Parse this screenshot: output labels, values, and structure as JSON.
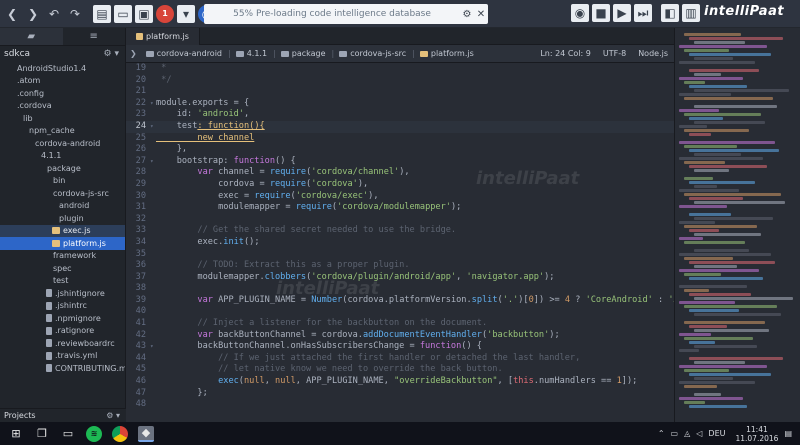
{
  "toolbar": {
    "status_text": "55% Pre-loading code intelligence database",
    "badge": "1"
  },
  "brand": {
    "name": "intelliPaat"
  },
  "watermark": "intelliPaat",
  "sidebar": {
    "root": "sdkca",
    "items": [
      {
        "label": "AndroidStudio1.4",
        "depth": 1,
        "type": "folder"
      },
      {
        "label": ".atom",
        "depth": 1,
        "type": "folder"
      },
      {
        "label": ".config",
        "depth": 1,
        "type": "folder"
      },
      {
        "label": ".cordova",
        "depth": 1,
        "type": "folder"
      },
      {
        "label": "lib",
        "depth": 2,
        "type": "folder"
      },
      {
        "label": "npm_cache",
        "depth": 3,
        "type": "folder"
      },
      {
        "label": "cordova-android",
        "depth": 4,
        "type": "folder"
      },
      {
        "label": "4.1.1",
        "depth": 5,
        "type": "folder"
      },
      {
        "label": "package",
        "depth": 6,
        "type": "folder"
      },
      {
        "label": "bin",
        "depth": 7,
        "type": "folder"
      },
      {
        "label": "cordova-js-src",
        "depth": 7,
        "type": "folder"
      },
      {
        "label": "android",
        "depth": 8,
        "type": "folder"
      },
      {
        "label": "plugin",
        "depth": 8,
        "type": "folder"
      },
      {
        "label": "exec.js",
        "depth": 8,
        "type": "js",
        "state": "hl"
      },
      {
        "label": "platform.js",
        "depth": 8,
        "type": "js",
        "state": "selected"
      },
      {
        "label": "framework",
        "depth": 7,
        "type": "folder"
      },
      {
        "label": "spec",
        "depth": 7,
        "type": "folder"
      },
      {
        "label": "test",
        "depth": 7,
        "type": "folder"
      },
      {
        "label": ".jshintignore",
        "depth": 7,
        "type": "file"
      },
      {
        "label": ".jshintrc",
        "depth": 7,
        "type": "file"
      },
      {
        "label": ".npmignore",
        "depth": 7,
        "type": "file"
      },
      {
        "label": ".ratignore",
        "depth": 7,
        "type": "file"
      },
      {
        "label": ".reviewboardrc",
        "depth": 7,
        "type": "file"
      },
      {
        "label": ".travis.yml",
        "depth": 7,
        "type": "file"
      },
      {
        "label": "CONTRIBUTING.md",
        "depth": 7,
        "type": "file"
      }
    ],
    "projects_label": "Projects"
  },
  "editor": {
    "tab_label": "platform.js",
    "breadcrumbs": [
      "cordova-android",
      "4.1.1",
      "package",
      "cordova-js-src",
      "platform.js"
    ],
    "cursor": "Ln: 24 Col: 9",
    "encoding": "UTF-8",
    "language": "Node.js",
    "lines": [
      {
        "n": "19",
        "tokens": [
          [
            "cm",
            " *"
          ]
        ]
      },
      {
        "n": "20",
        "tokens": [
          [
            "cm",
            " */"
          ]
        ]
      },
      {
        "n": "21",
        "tokens": []
      },
      {
        "n": "22",
        "fold": true,
        "tokens": [
          [
            "pl",
            "module.exports = {"
          ]
        ]
      },
      {
        "n": "23",
        "tokens": [
          [
            "pl",
            "    id: "
          ],
          [
            "str",
            "'android'"
          ],
          [
            "pl",
            ","
          ]
        ]
      },
      {
        "n": "24",
        "cur": true,
        "fold": true,
        "tokens": [
          [
            "pl",
            "    test"
          ],
          [
            "ul",
            ": function(){"
          ]
        ]
      },
      {
        "n": "25",
        "tokens": [
          [
            "ul",
            "        new channel"
          ]
        ]
      },
      {
        "n": "26",
        "tokens": [
          [
            "pl",
            "    },"
          ]
        ]
      },
      {
        "n": "27",
        "fold": true,
        "tokens": [
          [
            "pl",
            "    bootstrap: "
          ],
          [
            "kw",
            "function"
          ],
          [
            "pl",
            "() {"
          ]
        ]
      },
      {
        "n": "28",
        "tokens": [
          [
            "pl",
            "        "
          ],
          [
            "kw",
            "var"
          ],
          [
            "pl",
            " channel = "
          ],
          [
            "fn",
            "require"
          ],
          [
            "pl",
            "("
          ],
          [
            "str",
            "'cordova/channel'"
          ],
          [
            "pl",
            "),"
          ]
        ]
      },
      {
        "n": "29",
        "tokens": [
          [
            "pl",
            "            cordova = "
          ],
          [
            "fn",
            "require"
          ],
          [
            "pl",
            "("
          ],
          [
            "str",
            "'cordova'"
          ],
          [
            "pl",
            "),"
          ]
        ]
      },
      {
        "n": "30",
        "tokens": [
          [
            "pl",
            "            exec = "
          ],
          [
            "fn",
            "require"
          ],
          [
            "pl",
            "("
          ],
          [
            "str",
            "'cordova/exec'"
          ],
          [
            "pl",
            "),"
          ]
        ]
      },
      {
        "n": "31",
        "tokens": [
          [
            "pl",
            "            modulemapper = "
          ],
          [
            "fn",
            "require"
          ],
          [
            "pl",
            "("
          ],
          [
            "str",
            "'cordova/modulemapper'"
          ],
          [
            "pl",
            ");"
          ]
        ]
      },
      {
        "n": "32",
        "tokens": []
      },
      {
        "n": "33",
        "tokens": [
          [
            "cm",
            "        // Get the shared secret needed to use the bridge."
          ]
        ]
      },
      {
        "n": "34",
        "tokens": [
          [
            "pl",
            "        exec."
          ],
          [
            "fn",
            "init"
          ],
          [
            "pl",
            "();"
          ]
        ]
      },
      {
        "n": "35",
        "tokens": []
      },
      {
        "n": "36",
        "tokens": [
          [
            "cm",
            "        // TODO: Extract this as a proper plugin."
          ]
        ]
      },
      {
        "n": "37",
        "tokens": [
          [
            "pl",
            "        modulemapper."
          ],
          [
            "fn",
            "clobbers"
          ],
          [
            "pl",
            "("
          ],
          [
            "str",
            "'cordova/plugin/android/app'"
          ],
          [
            "pl",
            ", "
          ],
          [
            "str",
            "'navigator.app'"
          ],
          [
            "pl",
            ");"
          ]
        ]
      },
      {
        "n": "38",
        "tokens": []
      },
      {
        "n": "39",
        "tokens": [
          [
            "pl",
            "        "
          ],
          [
            "kw",
            "var"
          ],
          [
            "pl",
            " APP_PLUGIN_NAME = "
          ],
          [
            "fn",
            "Number"
          ],
          [
            "pl",
            "(cordova.platformVersion."
          ],
          [
            "fn",
            "split"
          ],
          [
            "pl",
            "("
          ],
          [
            "str",
            "'.'"
          ],
          [
            "pl",
            ")["
          ],
          [
            "num",
            "0"
          ],
          [
            "pl",
            "]) >= "
          ],
          [
            "num",
            "4"
          ],
          [
            "pl",
            " ? "
          ],
          [
            "str",
            "'CoreAndroid'"
          ],
          [
            "pl",
            " : "
          ],
          [
            "str",
            "'App'"
          ],
          [
            "pl",
            ";"
          ]
        ]
      },
      {
        "n": "40",
        "tokens": []
      },
      {
        "n": "41",
        "tokens": [
          [
            "cm",
            "        // Inject a listener for the backbutton on the document."
          ]
        ]
      },
      {
        "n": "42",
        "tokens": [
          [
            "pl",
            "        "
          ],
          [
            "kw",
            "var"
          ],
          [
            "pl",
            " backButtonChannel = cordova."
          ],
          [
            "fn",
            "addDocumentEventHandler"
          ],
          [
            "pl",
            "("
          ],
          [
            "str",
            "'backbutton'"
          ],
          [
            "pl",
            ");"
          ]
        ]
      },
      {
        "n": "43",
        "fold": true,
        "tokens": [
          [
            "pl",
            "        backButtonChannel.onHasSubscribersChange = "
          ],
          [
            "kw",
            "function"
          ],
          [
            "pl",
            "() {"
          ]
        ]
      },
      {
        "n": "44",
        "tokens": [
          [
            "cm",
            "            // If we just attached the first handler or detached the last handler,"
          ]
        ]
      },
      {
        "n": "45",
        "tokens": [
          [
            "cm",
            "            // let native know we need to override the back button."
          ]
        ]
      },
      {
        "n": "46",
        "tokens": [
          [
            "pl",
            "            "
          ],
          [
            "fn",
            "exec"
          ],
          [
            "pl",
            "("
          ],
          [
            "const",
            "null"
          ],
          [
            "pl",
            ", "
          ],
          [
            "const",
            "null"
          ],
          [
            "pl",
            ", APP_PLUGIN_NAME, "
          ],
          [
            "str",
            "\"overrideBackbutton\""
          ],
          [
            "pl",
            ", ["
          ],
          [
            "prop",
            "this"
          ],
          [
            "pl",
            ".numHandlers == "
          ],
          [
            "num",
            "1"
          ],
          [
            "pl",
            "]);"
          ]
        ]
      },
      {
        "n": "47",
        "tokens": [
          [
            "pl",
            "        };"
          ]
        ]
      },
      {
        "n": "48",
        "tokens": []
      }
    ]
  },
  "taskbar": {
    "lang": "DEU",
    "time": "11:41",
    "date": "11.07.2016"
  },
  "colors": {
    "accent": "#2d66c8",
    "string": "#98c379",
    "keyword": "#c678dd",
    "function": "#61afef",
    "comment": "#5c6370"
  }
}
